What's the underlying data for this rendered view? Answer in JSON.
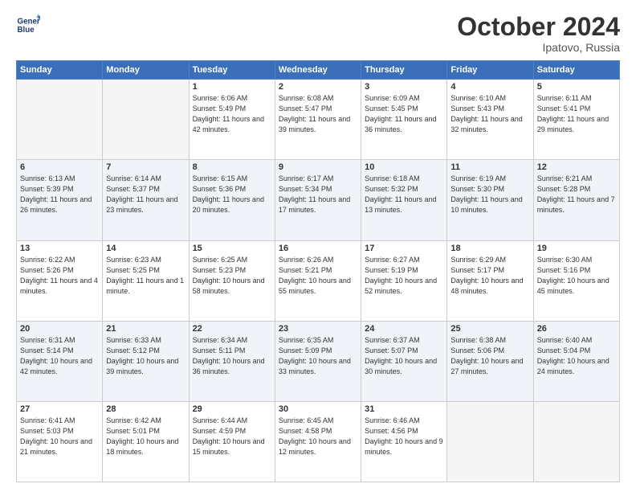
{
  "header": {
    "logo_line1": "General",
    "logo_line2": "Blue",
    "month": "October 2024",
    "location": "Ipatovo, Russia"
  },
  "weekdays": [
    "Sunday",
    "Monday",
    "Tuesday",
    "Wednesday",
    "Thursday",
    "Friday",
    "Saturday"
  ],
  "weeks": [
    [
      {
        "day": "",
        "info": ""
      },
      {
        "day": "",
        "info": ""
      },
      {
        "day": "1",
        "info": "Sunrise: 6:06 AM\nSunset: 5:49 PM\nDaylight: 11 hours and 42 minutes."
      },
      {
        "day": "2",
        "info": "Sunrise: 6:08 AM\nSunset: 5:47 PM\nDaylight: 11 hours and 39 minutes."
      },
      {
        "day": "3",
        "info": "Sunrise: 6:09 AM\nSunset: 5:45 PM\nDaylight: 11 hours and 36 minutes."
      },
      {
        "day": "4",
        "info": "Sunrise: 6:10 AM\nSunset: 5:43 PM\nDaylight: 11 hours and 32 minutes."
      },
      {
        "day": "5",
        "info": "Sunrise: 6:11 AM\nSunset: 5:41 PM\nDaylight: 11 hours and 29 minutes."
      }
    ],
    [
      {
        "day": "6",
        "info": "Sunrise: 6:13 AM\nSunset: 5:39 PM\nDaylight: 11 hours and 26 minutes."
      },
      {
        "day": "7",
        "info": "Sunrise: 6:14 AM\nSunset: 5:37 PM\nDaylight: 11 hours and 23 minutes."
      },
      {
        "day": "8",
        "info": "Sunrise: 6:15 AM\nSunset: 5:36 PM\nDaylight: 11 hours and 20 minutes."
      },
      {
        "day": "9",
        "info": "Sunrise: 6:17 AM\nSunset: 5:34 PM\nDaylight: 11 hours and 17 minutes."
      },
      {
        "day": "10",
        "info": "Sunrise: 6:18 AM\nSunset: 5:32 PM\nDaylight: 11 hours and 13 minutes."
      },
      {
        "day": "11",
        "info": "Sunrise: 6:19 AM\nSunset: 5:30 PM\nDaylight: 11 hours and 10 minutes."
      },
      {
        "day": "12",
        "info": "Sunrise: 6:21 AM\nSunset: 5:28 PM\nDaylight: 11 hours and 7 minutes."
      }
    ],
    [
      {
        "day": "13",
        "info": "Sunrise: 6:22 AM\nSunset: 5:26 PM\nDaylight: 11 hours and 4 minutes."
      },
      {
        "day": "14",
        "info": "Sunrise: 6:23 AM\nSunset: 5:25 PM\nDaylight: 11 hours and 1 minute."
      },
      {
        "day": "15",
        "info": "Sunrise: 6:25 AM\nSunset: 5:23 PM\nDaylight: 10 hours and 58 minutes."
      },
      {
        "day": "16",
        "info": "Sunrise: 6:26 AM\nSunset: 5:21 PM\nDaylight: 10 hours and 55 minutes."
      },
      {
        "day": "17",
        "info": "Sunrise: 6:27 AM\nSunset: 5:19 PM\nDaylight: 10 hours and 52 minutes."
      },
      {
        "day": "18",
        "info": "Sunrise: 6:29 AM\nSunset: 5:17 PM\nDaylight: 10 hours and 48 minutes."
      },
      {
        "day": "19",
        "info": "Sunrise: 6:30 AM\nSunset: 5:16 PM\nDaylight: 10 hours and 45 minutes."
      }
    ],
    [
      {
        "day": "20",
        "info": "Sunrise: 6:31 AM\nSunset: 5:14 PM\nDaylight: 10 hours and 42 minutes."
      },
      {
        "day": "21",
        "info": "Sunrise: 6:33 AM\nSunset: 5:12 PM\nDaylight: 10 hours and 39 minutes."
      },
      {
        "day": "22",
        "info": "Sunrise: 6:34 AM\nSunset: 5:11 PM\nDaylight: 10 hours and 36 minutes."
      },
      {
        "day": "23",
        "info": "Sunrise: 6:35 AM\nSunset: 5:09 PM\nDaylight: 10 hours and 33 minutes."
      },
      {
        "day": "24",
        "info": "Sunrise: 6:37 AM\nSunset: 5:07 PM\nDaylight: 10 hours and 30 minutes."
      },
      {
        "day": "25",
        "info": "Sunrise: 6:38 AM\nSunset: 5:06 PM\nDaylight: 10 hours and 27 minutes."
      },
      {
        "day": "26",
        "info": "Sunrise: 6:40 AM\nSunset: 5:04 PM\nDaylight: 10 hours and 24 minutes."
      }
    ],
    [
      {
        "day": "27",
        "info": "Sunrise: 6:41 AM\nSunset: 5:03 PM\nDaylight: 10 hours and 21 minutes."
      },
      {
        "day": "28",
        "info": "Sunrise: 6:42 AM\nSunset: 5:01 PM\nDaylight: 10 hours and 18 minutes."
      },
      {
        "day": "29",
        "info": "Sunrise: 6:44 AM\nSunset: 4:59 PM\nDaylight: 10 hours and 15 minutes."
      },
      {
        "day": "30",
        "info": "Sunrise: 6:45 AM\nSunset: 4:58 PM\nDaylight: 10 hours and 12 minutes."
      },
      {
        "day": "31",
        "info": "Sunrise: 6:46 AM\nSunset: 4:56 PM\nDaylight: 10 hours and 9 minutes."
      },
      {
        "day": "",
        "info": ""
      },
      {
        "day": "",
        "info": ""
      }
    ]
  ]
}
